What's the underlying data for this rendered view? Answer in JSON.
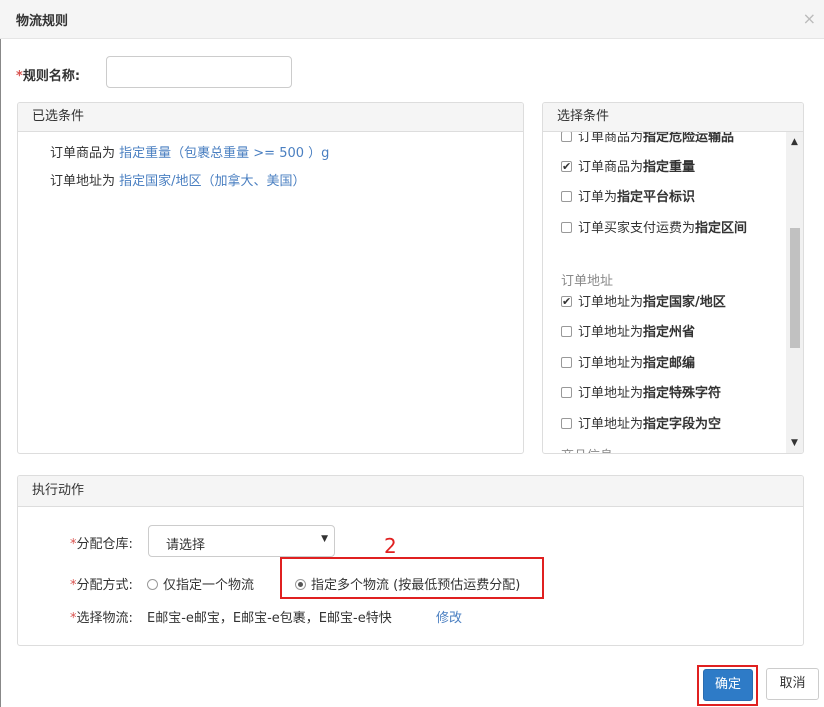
{
  "dialog": {
    "title": "物流规则",
    "close_icon": "×"
  },
  "rule": {
    "required_mark": "*",
    "label": "规则名称:",
    "value": ""
  },
  "selected": {
    "title": "已选条件",
    "lines": [
      {
        "prefix": "订单商品为",
        "value": "指定重量（包裹总重量 >= 500 ）g"
      },
      {
        "prefix": "订单地址为",
        "value": "指定国家/地区（加拿大、美国）"
      }
    ]
  },
  "options": {
    "title": "选择条件",
    "items": [
      {
        "prefix": "订单商品为",
        "bold": "指定危险运输品",
        "checked": false
      },
      {
        "prefix": "订单商品为",
        "bold": "指定重量",
        "checked": true
      },
      {
        "prefix": "订单为",
        "bold": "指定平台标识",
        "checked": false
      },
      {
        "prefix": "订单买家支付运费为",
        "bold": "指定区间",
        "checked": false
      },
      {
        "prefix": "订单地址为",
        "bold": "指定国家/地区",
        "checked": true
      },
      {
        "prefix": "订单地址为",
        "bold": "指定州省",
        "checked": false
      },
      {
        "prefix": "订单地址为",
        "bold": "指定邮编",
        "checked": false
      },
      {
        "prefix": "订单地址为",
        "bold": "指定特殊字符",
        "checked": false
      },
      {
        "prefix": "订单地址为",
        "bold": "指定字段为空",
        "checked": false
      }
    ],
    "groups": [
      "订单地址",
      "商品信息"
    ],
    "scroll_up": "▲",
    "scroll_down": "▼"
  },
  "action": {
    "title": "执行动作",
    "warehouse": {
      "required_mark": "*",
      "label": "分配仓库:",
      "value": "请选择",
      "caret": "▼"
    },
    "method": {
      "required_mark": "*",
      "label": "分配方式:",
      "option1": "仅指定一个物流",
      "option2": "指定多个物流 (按最低预估运费分配)",
      "selected": "option2"
    },
    "logistics": {
      "required_mark": "*",
      "label": "选择物流:",
      "value": "E邮宝-e邮宝，E邮宝-e包裹，E邮宝-e特快",
      "edit_label": "修改"
    }
  },
  "annotation": {
    "number": "2",
    "color": "#e02020"
  },
  "buttons": {
    "ok": "确定",
    "cancel": "取消"
  },
  "colors": {
    "primary": "#2e7bc7",
    "link": "#4a7fc1",
    "required": "#d9534f"
  }
}
